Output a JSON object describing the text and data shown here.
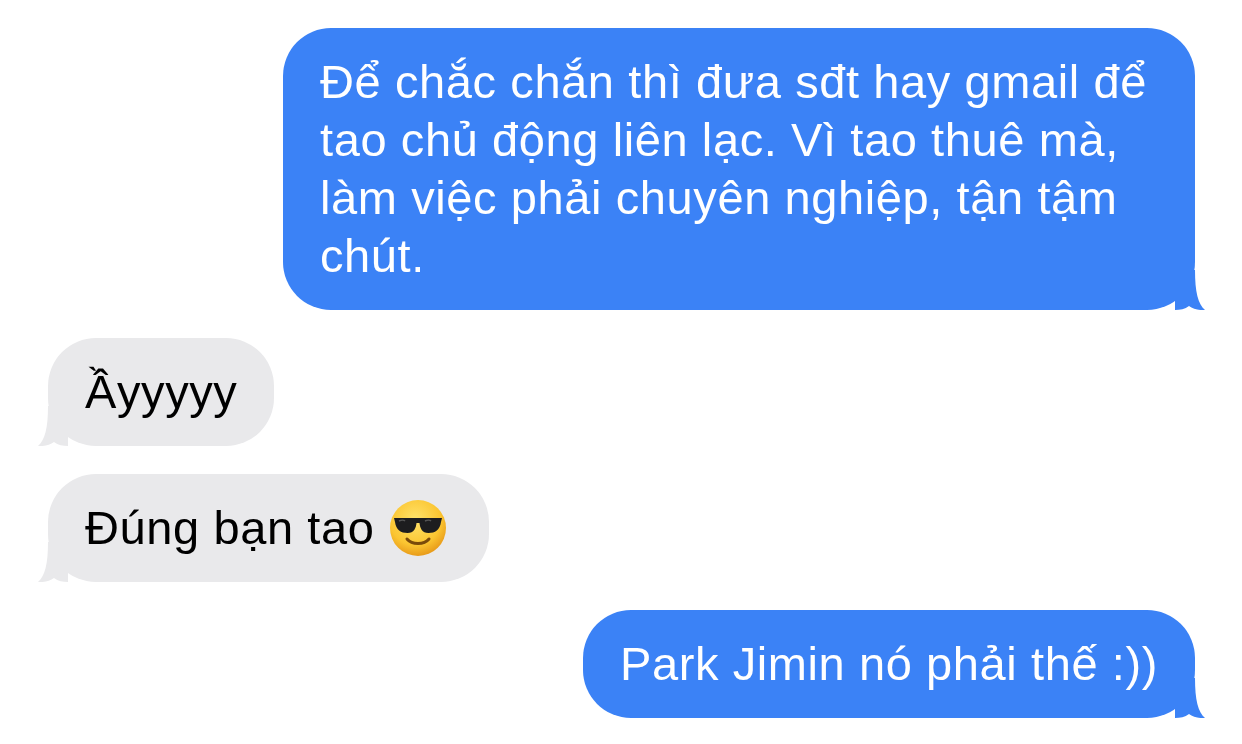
{
  "messages": [
    {
      "sent": true,
      "text": "Để chắc chắn thì đưa sđt hay gmail để tao chủ động liên lạc. Vì tao thuê mà, làm việc phải chuyên nghiệp, tận tậm chút.",
      "emoji": false
    },
    {
      "sent": false,
      "text": "Ầyyyyy",
      "emoji": false
    },
    {
      "sent": false,
      "text": "Đúng bạn tao",
      "emoji": true
    },
    {
      "sent": true,
      "text": "Park Jimin nó phải thế :))",
      "emoji": false
    }
  ]
}
